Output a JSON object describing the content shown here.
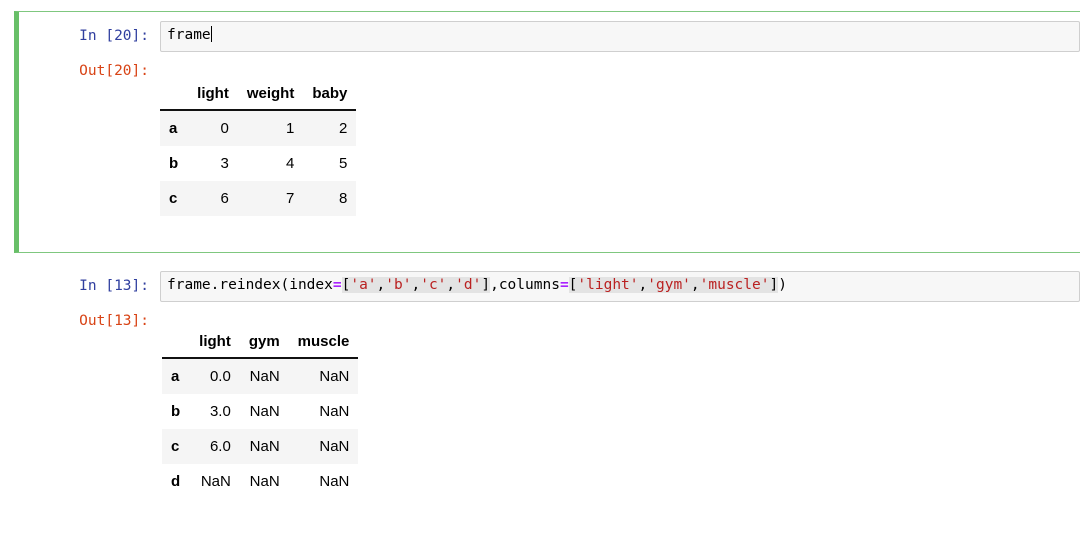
{
  "notebook": {
    "cells": [
      {
        "id": "cell-1",
        "selected": true,
        "input_prompt": "In [20]:",
        "output_prompt": "Out[20]:",
        "source": "frame",
        "has_caret": true,
        "table": {
          "index_header": "",
          "columns": [
            "light",
            "weight",
            "baby"
          ],
          "index": [
            "a",
            "b",
            "c"
          ],
          "rows": [
            [
              "0",
              "1",
              "2"
            ],
            [
              "3",
              "4",
              "5"
            ],
            [
              "6",
              "7",
              "8"
            ]
          ]
        }
      },
      {
        "id": "cell-2",
        "selected": false,
        "input_prompt": "In [13]:",
        "output_prompt": "Out[13]:",
        "source": "frame.reindex(index=['a','b','c','d'],columns=['light','gym','muscle'])",
        "has_caret": false,
        "code_tokens": [
          {
            "text": "frame.reindex(index",
            "type": "plain"
          },
          {
            "text": "=",
            "type": "operator"
          },
          {
            "text": "[",
            "type": "plain"
          },
          {
            "text": "'a'",
            "type": "string"
          },
          {
            "text": ",",
            "type": "plain"
          },
          {
            "text": "'b'",
            "type": "string"
          },
          {
            "text": ",",
            "type": "plain"
          },
          {
            "text": "'c'",
            "type": "string"
          },
          {
            "text": ",",
            "type": "plain"
          },
          {
            "text": "'d'",
            "type": "string"
          },
          {
            "text": "]",
            "type": "plain"
          },
          {
            "text": ",columns",
            "type": "plain"
          },
          {
            "text": "=",
            "type": "operator"
          },
          {
            "text": "[",
            "type": "plain"
          },
          {
            "text": "'light'",
            "type": "string"
          },
          {
            "text": ",",
            "type": "plain"
          },
          {
            "text": "'gym'",
            "type": "string"
          },
          {
            "text": ",",
            "type": "plain"
          },
          {
            "text": "'muscle'",
            "type": "string"
          },
          {
            "text": "]",
            "type": "plain"
          },
          {
            "text": ")",
            "type": "plain"
          }
        ],
        "table": {
          "index_header": "",
          "columns": [
            "light",
            "gym",
            "muscle"
          ],
          "index": [
            "a",
            "b",
            "c",
            "d"
          ],
          "rows": [
            [
              "0.0",
              "NaN",
              "NaN"
            ],
            [
              "3.0",
              "NaN",
              "NaN"
            ],
            [
              "6.0",
              "NaN",
              "NaN"
            ],
            [
              "NaN",
              "NaN",
              "NaN"
            ]
          ]
        }
      }
    ]
  },
  "colors": {
    "in_prompt": "#303F9F",
    "out_prompt": "#D84315",
    "selected_border": "#68bf68",
    "code_string": "#BA2121",
    "code_operator": "#AA22FF",
    "input_background": "#f7f7f7",
    "row_stripe": "#f5f5f5"
  }
}
